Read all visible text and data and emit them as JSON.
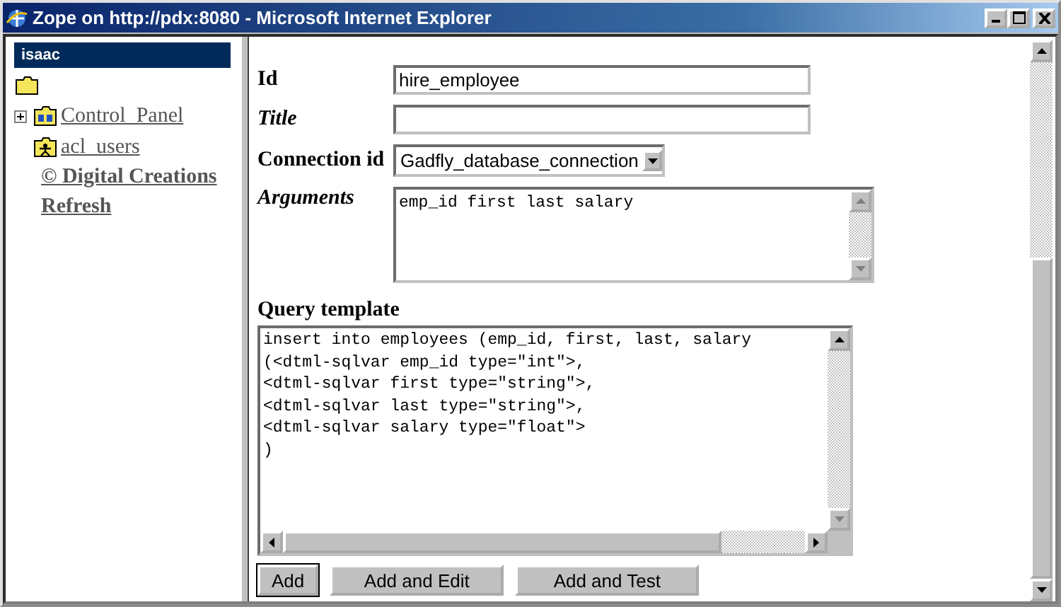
{
  "window": {
    "title": "Zope on http://pdx:8080 - Microsoft Internet Explorer"
  },
  "sidebar": {
    "header": "isaac",
    "tree": [
      {
        "label": "Control_Panel",
        "kind": "control-panel",
        "expandable": true
      },
      {
        "label": "acl_users",
        "kind": "user-folder",
        "expandable": false
      }
    ],
    "links": [
      "© Digital Creations",
      "Refresh"
    ]
  },
  "form": {
    "fields": [
      {
        "label": "Id",
        "kind": "text",
        "italic": false,
        "value": "hire_employee"
      },
      {
        "label": "Title",
        "kind": "text",
        "italic": true
      },
      {
        "label": "Connection id",
        "kind": "select",
        "italic": false,
        "value": "Gadfly_database_connection"
      },
      {
        "label": "Arguments",
        "kind": "textarea",
        "italic": true,
        "value": "emp_id first last salary"
      }
    ],
    "query_template": {
      "label": "Query template",
      "lines": [
        "insert into employees (emp_id, first, last, salary",
        "(<dtml-sqlvar emp_id type=\"int\">,",
        "<dtml-sqlvar first type=\"string\">,",
        "<dtml-sqlvar last type=\"string\">,",
        "<dtml-sqlvar salary type=\"float\">",
        ")"
      ]
    },
    "buttons": [
      {
        "label": "Add",
        "default": true
      },
      {
        "label": "Add and Edit",
        "default": false
      },
      {
        "label": "Add and Test",
        "default": false
      }
    ]
  }
}
